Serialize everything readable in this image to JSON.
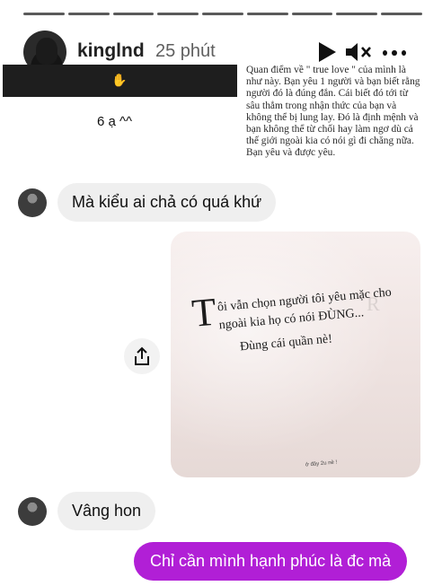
{
  "story": {
    "username": "kinglnd",
    "time_ago": "25 phút",
    "progress_segments": 9,
    "note_text": "Quan điểm về \" true love \" của mình là như này. Bạn yêu 1 người và bạn biết rằng người đó là đúng đắn. Cái biết đó tới từ sâu thẳm trong nhận thức của bạn và không thể bị lung lay. Đó là định mệnh và bạn không thể từ chối hay làm ngơ dù cả thế giới ngoài kia có nói gì đi chăng nữa. Bạn yêu và được yêu.",
    "reply_text": "6 ạ ^^",
    "hand_emoji": "✋"
  },
  "messages": {
    "m1": "Mà kiểu ai chả có quá khứ",
    "photo": {
      "dropcap": "T",
      "line1": "ôi vẫn chọn người tôi yêu mặc cho",
      "line2": "ngoài kia họ có nói ĐÙNG...",
      "line3": "Đùng cái quần nè!",
      "credit": "ở đây 2u nè !"
    },
    "m2": "Vâng hon",
    "m3": "Chỉ cần mình hạnh phúc là đc mà"
  },
  "colors": {
    "outgoing_bubble": "#b11fd6",
    "incoming_bubble": "#efefef",
    "progress": "#5a5a5a"
  },
  "icons": {
    "play": "play-icon",
    "mute": "mute-icon",
    "more": "more-icon",
    "share": "share-icon"
  }
}
